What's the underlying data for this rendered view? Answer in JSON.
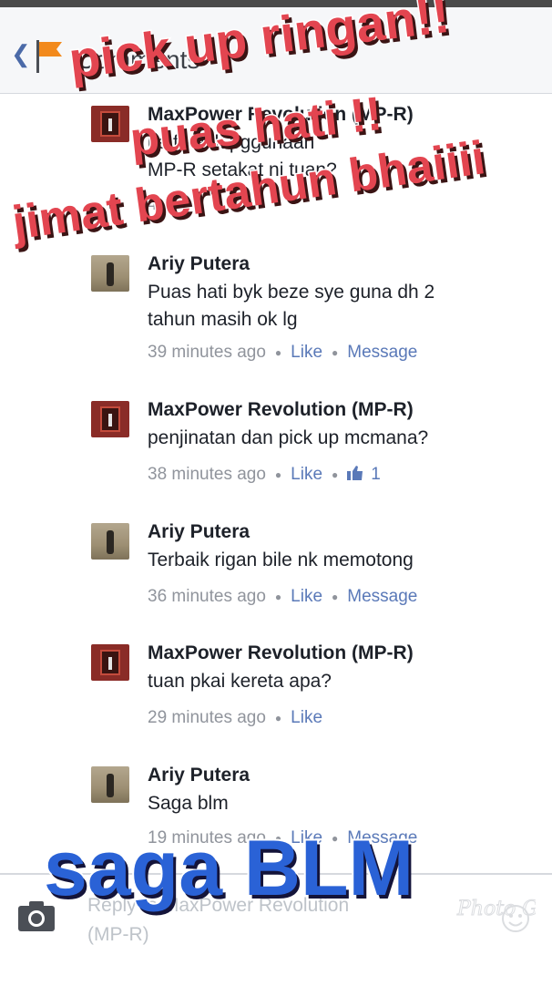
{
  "header": {
    "title": "Comments"
  },
  "comments": [
    {
      "author": "MaxPower Revolution (MP-R)",
      "author_partial": "MaxPower R",
      "author_tail": "(MP-R)",
      "text_line1_partial": "ke",
      "text_line1_mid": "fe",
      "text_line1_tail": "ack pggunaan",
      "text_line2": "MP-R setakat ni tuan?",
      "time_partial": "4"
    },
    {
      "author": "Ariy Putera",
      "text": "Puas hati byk beze sye guna dh 2 tahun masih ok lg",
      "time": "39 minutes ago",
      "like": "Like",
      "message": "Message"
    },
    {
      "author": "MaxPower Revolution (MP-R)",
      "text": "penjinatan dan pick up mcmana?",
      "time": "38 minutes ago",
      "like": "Like",
      "like_count": "1"
    },
    {
      "author": "Ariy Putera",
      "text": "Terbaik rigan bile nk memotong",
      "time": "36 minutes ago",
      "like": "Like",
      "message": "Message"
    },
    {
      "author": "MaxPower Revolution (MP-R)",
      "text": "tuan pkai kereta apa?",
      "time": "29 minutes ago",
      "like": "Like"
    },
    {
      "author": "Ariy Putera",
      "text": "Saga blm",
      "time": "19 minutes ago",
      "like": "Like",
      "message": "Message"
    }
  ],
  "reply_box": {
    "placeholder_line1": "Reply to MaxPower Revolution",
    "placeholder_line2": "(MP-R)"
  },
  "overlays": {
    "line1": "pick up ringan!!",
    "line2": "puas hati !!",
    "line3": "jimat bertahun bhaiiii",
    "line4": "saga BLM"
  },
  "watermark": "Photo Grid",
  "colors": {
    "overlay_red": "#e34550",
    "overlay_blue": "#2a62d6",
    "link": "#5a79b8",
    "meta": "#90949c"
  }
}
